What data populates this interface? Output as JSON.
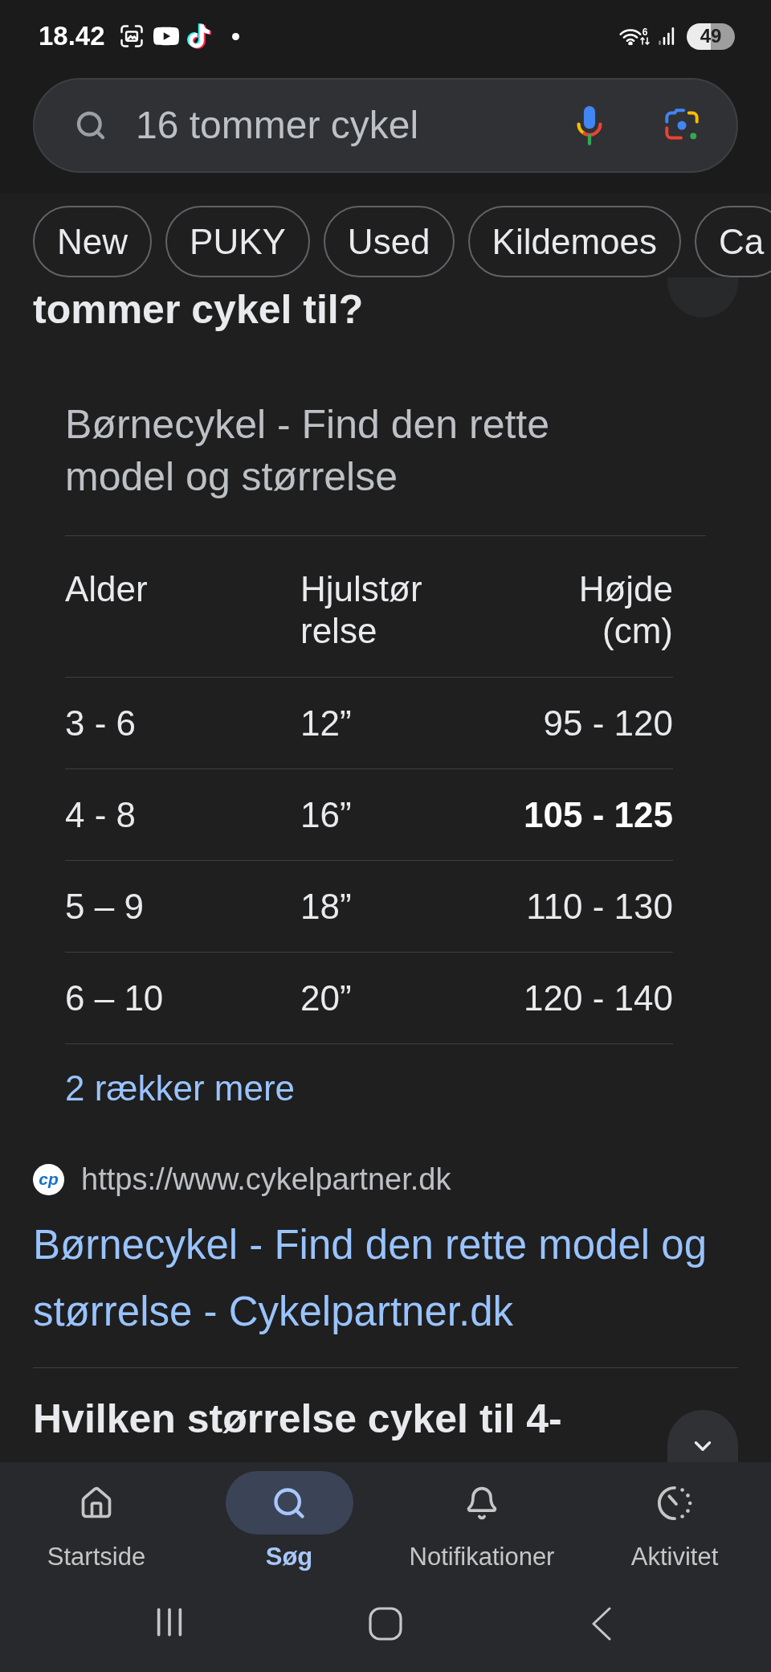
{
  "status_bar": {
    "time": "18.42",
    "wifi_label": "6",
    "battery": "49"
  },
  "search": {
    "query": "16 tommer cykel"
  },
  "chips": [
    "New",
    "PUKY",
    "Used",
    "Kildemoes",
    "Ca"
  ],
  "question": "tommer cykel til?",
  "snippet": {
    "title": "Børnecykel - Find den rette model og størrelse",
    "columns": [
      "Alder",
      "Hjulstørrelse",
      "Højde (cm)"
    ],
    "rows": [
      {
        "cells": [
          {
            "text": "3 - 6",
            "bold": false
          },
          {
            "text": "12”",
            "bold": false
          },
          {
            "text": "95 - 120",
            "bold": false
          }
        ]
      },
      {
        "cells": [
          {
            "text": "4 - 8",
            "bold": false
          },
          {
            "text": "16”",
            "bold": false
          },
          {
            "text": "105 - 125",
            "bold": true
          }
        ]
      },
      {
        "cells": [
          {
            "text": "5 – 9",
            "bold": false
          },
          {
            "text": "18”",
            "bold": false
          },
          {
            "text": "110 - 130",
            "bold": false
          }
        ]
      },
      {
        "cells": [
          {
            "text": "6 – 10",
            "bold": false
          },
          {
            "text": "20”",
            "bold": false
          },
          {
            "text": "120 - 140",
            "bold": false
          }
        ]
      }
    ],
    "more_rows": "2 rækker mere",
    "source_logo": "cp",
    "source_url": "https://www.cykelpartner.dk",
    "source_title": "Børnecykel - Find den rette model og størrelse - Cykelpartner.dk"
  },
  "next_question": "Hvilken størrelse cykel til 4-",
  "bottom_nav": [
    {
      "label": "Startside",
      "selected": false
    },
    {
      "label": "Søg",
      "selected": true
    },
    {
      "label": "Notifikationer",
      "selected": false
    },
    {
      "label": "Aktivitet",
      "selected": false
    }
  ]
}
